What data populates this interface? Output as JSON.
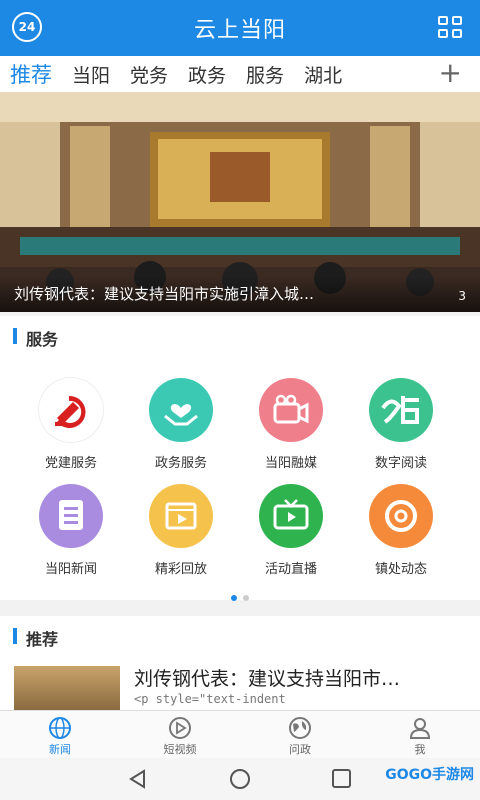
{
  "header": {
    "title": "云上当阳",
    "badge": "24"
  },
  "tabs": [
    "推荐",
    "当阳",
    "党务",
    "政务",
    "服务",
    "湖北"
  ],
  "tabs_plus": "+",
  "banner": {
    "caption": "刘传钢代表：建议支持当阳市实施引漳入城…",
    "page": "3"
  },
  "services_section": {
    "title": "服务"
  },
  "services": [
    {
      "label": "党建服务",
      "color": "#ffffff",
      "icon": "party-emblem-icon"
    },
    {
      "label": "政务服务",
      "color": "#3cc9b4",
      "icon": "heart-hands-icon"
    },
    {
      "label": "当阳融媒",
      "color": "#f07f8c",
      "icon": "video-camera-icon"
    },
    {
      "label": "数字阅读",
      "color": "#3cc28e",
      "icon": "reading-logo-icon"
    },
    {
      "label": "当阳新闻",
      "color": "#a98ce0",
      "icon": "document-icon"
    },
    {
      "label": "精彩回放",
      "color": "#f5c24c",
      "icon": "film-play-icon"
    },
    {
      "label": "活动直播",
      "color": "#2eb34f",
      "icon": "tv-icon"
    },
    {
      "label": "镇处动态",
      "color": "#f58a3b",
      "icon": "refresh-circle-icon"
    }
  ],
  "recommend_section": {
    "title": "推荐"
  },
  "news": {
    "title": "刘传钢代表：建议支持当阳市…",
    "snippet": "<p style=\"text-indent"
  },
  "bottom_nav": [
    "新闻",
    "短视频",
    "问政",
    "我"
  ],
  "watermark": "GOGO手游网",
  "colors": {
    "primary": "#1e88e5"
  }
}
